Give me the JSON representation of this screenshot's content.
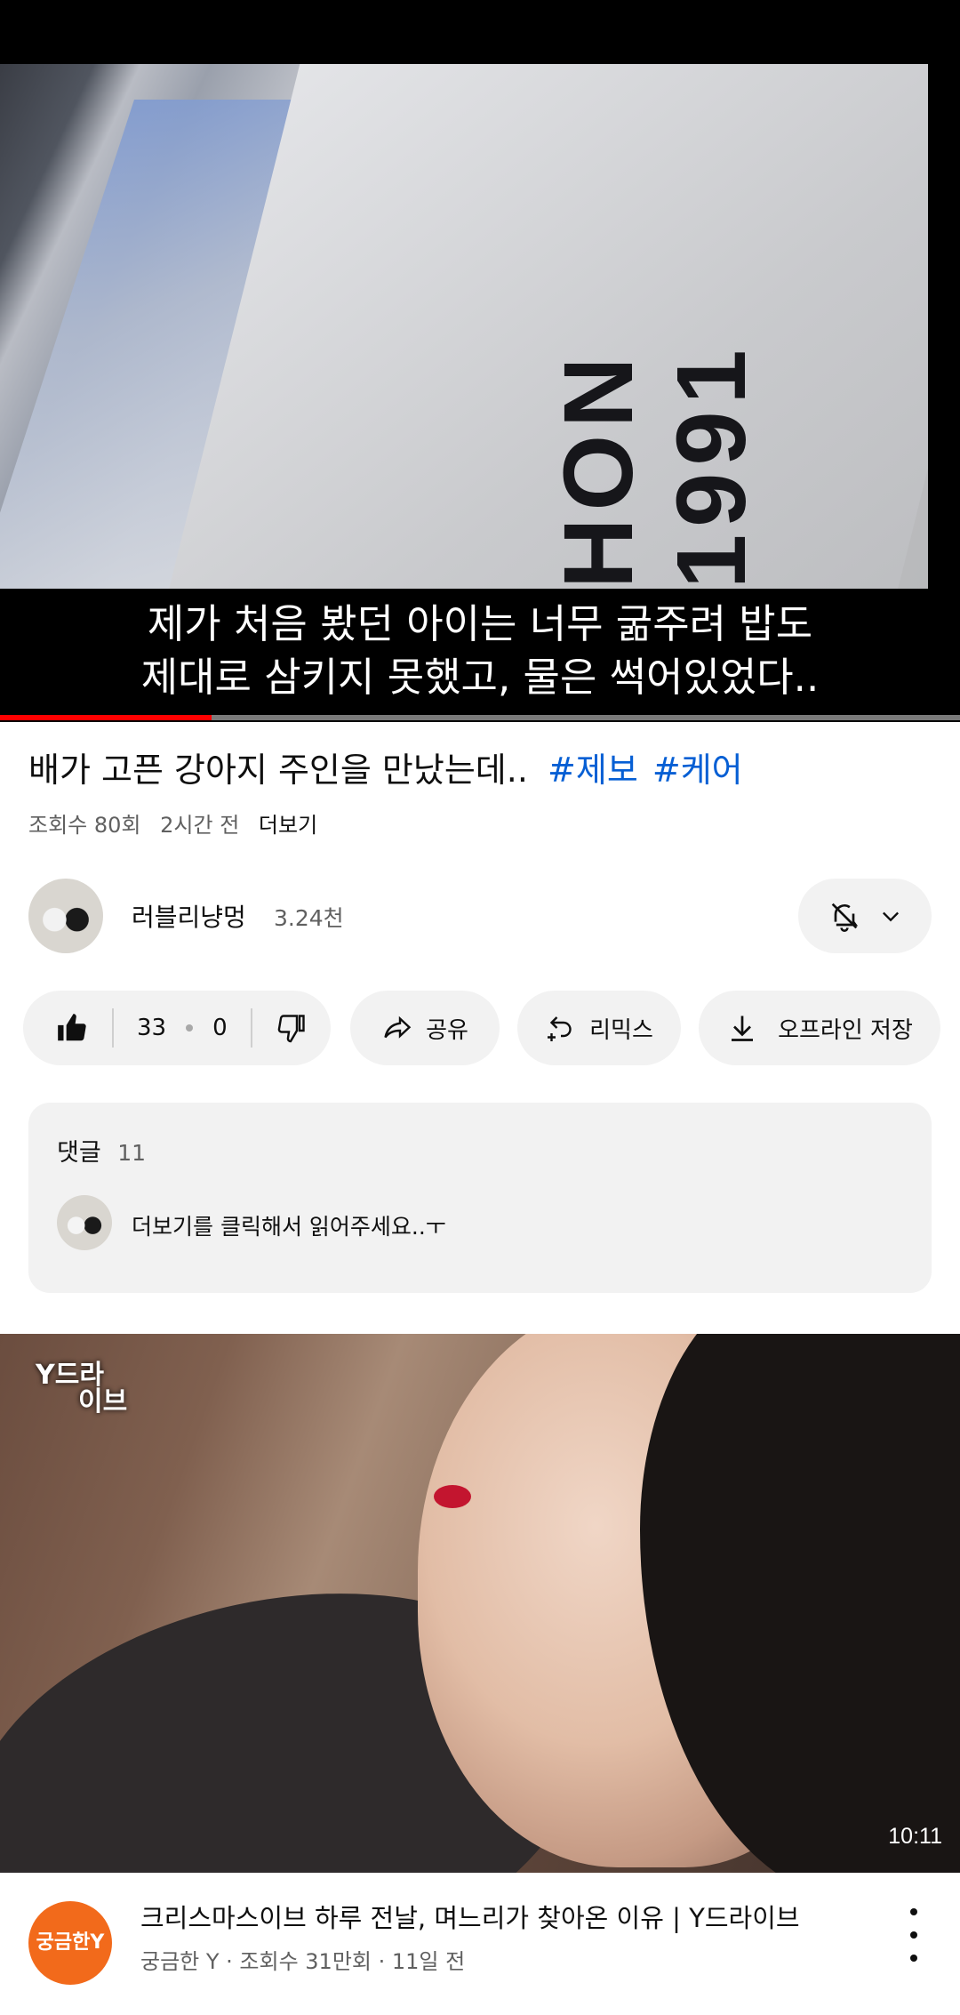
{
  "player": {
    "subtitle_line1": "제가 처음 봤던 아이는 너무 굶주려 밥도",
    "subtitle_line2": "제대로 삼키지 못했고, 물은 썩어있었다..",
    "printed_text": "HON 1991",
    "progress_fraction": 0.22
  },
  "video": {
    "title": "배가 고픈 강아지 주인을 만났는데..",
    "tags": [
      "#제보",
      "#케어"
    ],
    "views": "조회수 80회",
    "age": "2시간 전",
    "more": "더보기"
  },
  "channel": {
    "name": "러블리냥멍",
    "subscribers": "3.24천"
  },
  "actions": {
    "likes": "33",
    "dislikes": "0",
    "share": "공유",
    "remix": "리믹스",
    "download": "오프라인 저장"
  },
  "comments": {
    "label": "댓글",
    "count": "11",
    "top_comment": "더보기를 클릭해서 읽어주세요..ㅜ"
  },
  "recommended": {
    "thumb_logo_line1": "Y드라",
    "thumb_logo_line2": "이브",
    "duration": "10:11",
    "channel_avatar_text": "궁금한Y",
    "title": "크리스마스이브 하루 전날, 며느리가 찾아온 이유 | Y드라이브",
    "meta": "궁금한 Y · 조회수 31만회 · 11일 전"
  },
  "colors": {
    "accent_red": "#ff0000",
    "tag_blue": "#065fd4",
    "pill_gray": "#f2f2f2",
    "channel_orange": "#f26a1b"
  }
}
